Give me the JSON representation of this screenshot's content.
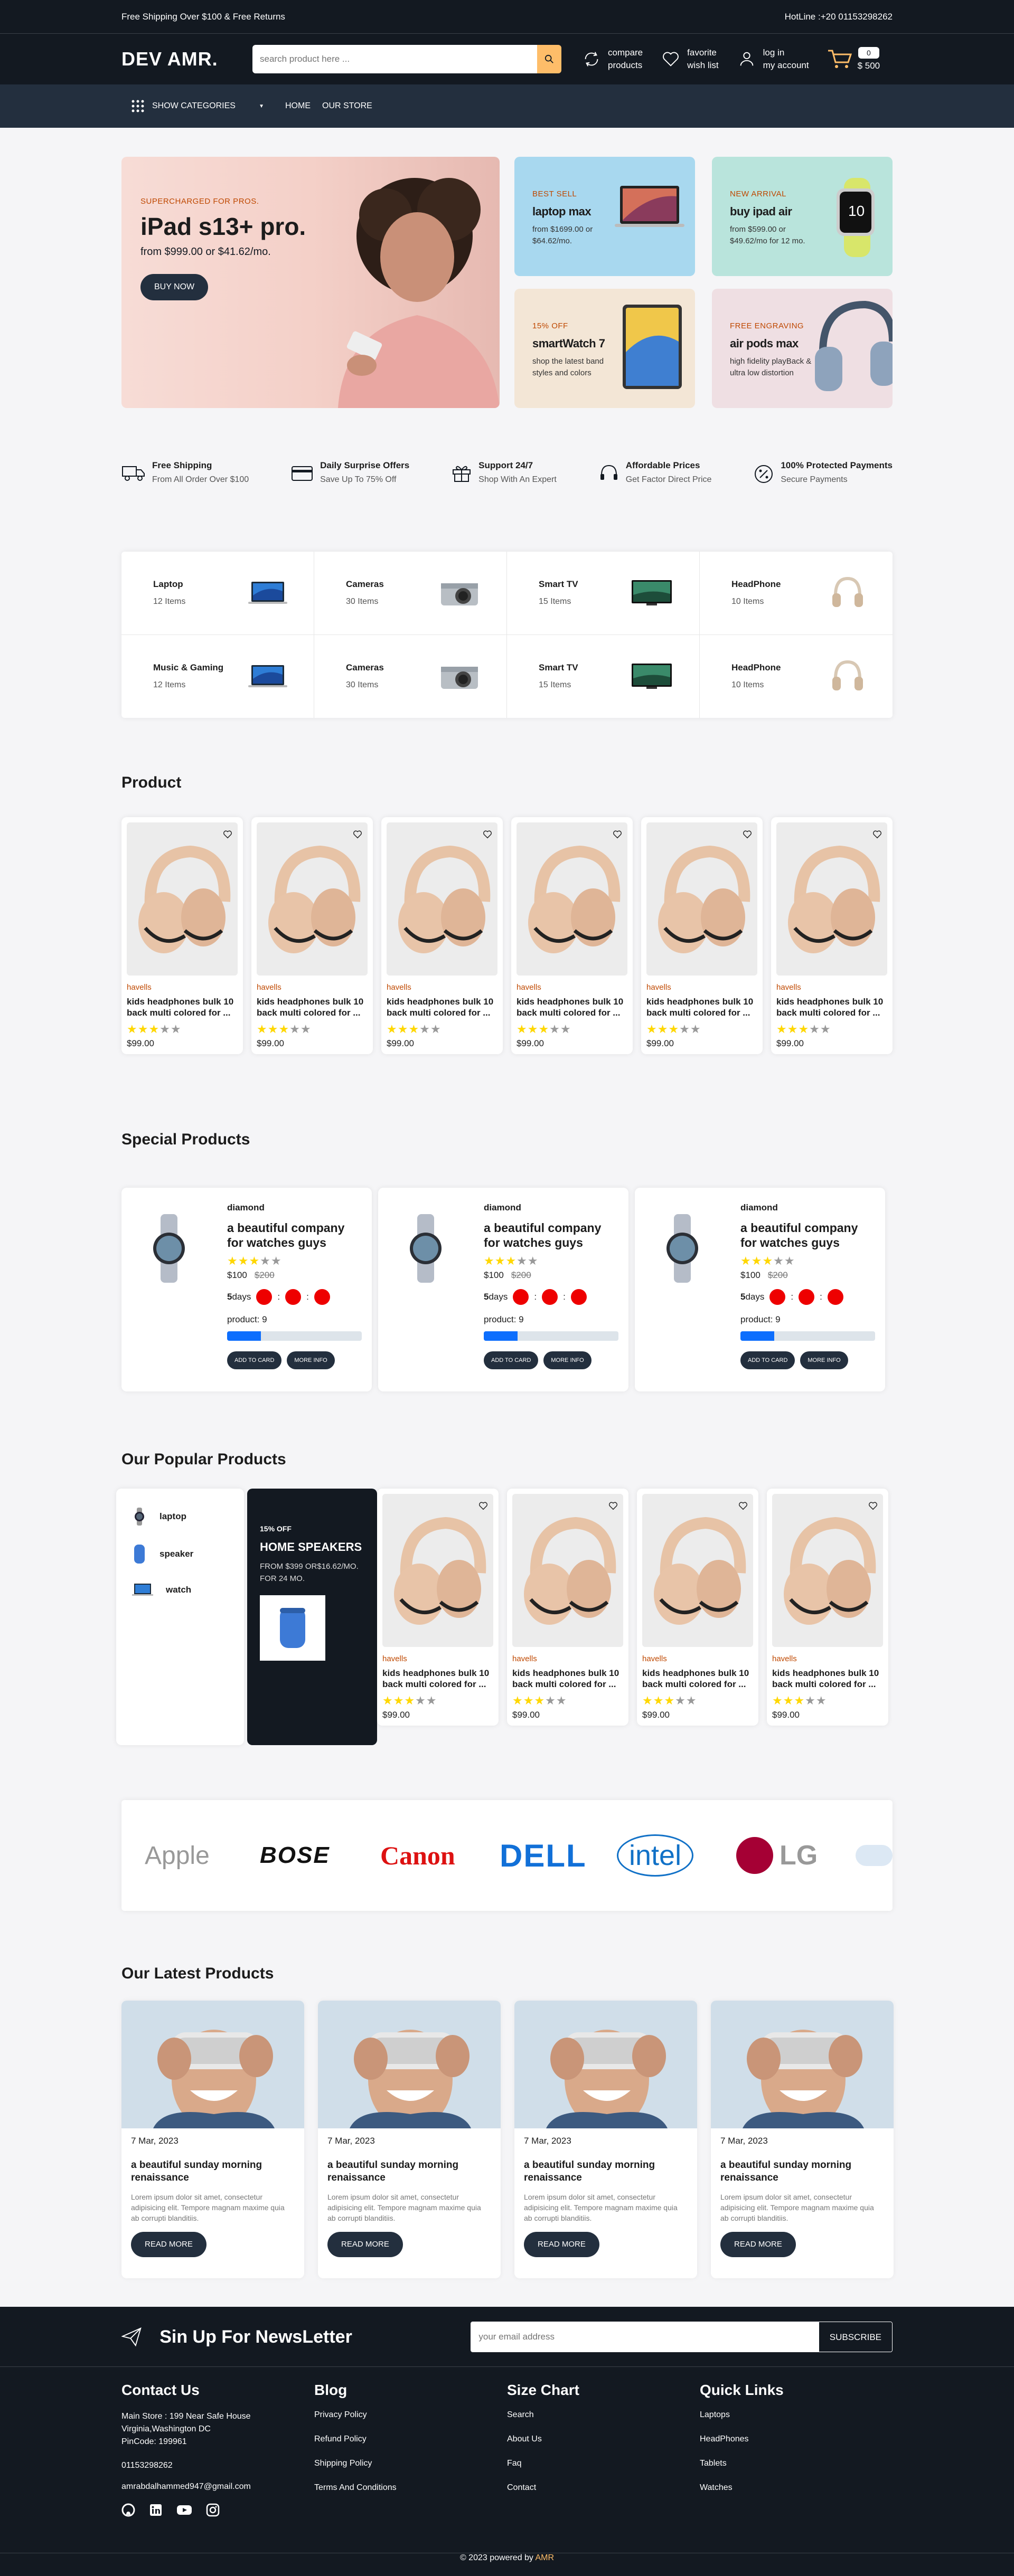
{
  "topbar": {
    "shipping": "Free Shipping Over $100 & Free Returns",
    "hotline": "HotLine :+20 01153298262"
  },
  "header": {
    "logo": "DEV AMR.",
    "search_placeholder": "search product here ...",
    "compare": [
      "compare",
      "products"
    ],
    "favorite": [
      "favorite",
      "wish list"
    ],
    "login": [
      "log in",
      "my account"
    ],
    "cart_count": "0",
    "cart_total": "$ 500"
  },
  "nav": {
    "categories": "SHOW CATEGORIES",
    "links": [
      "HOME",
      "OUR STORE"
    ]
  },
  "hero": {
    "main": {
      "sub": "SUPERCHARGED FOR PROS.",
      "title": "iPad s13+ pro.",
      "price": "from $999.00 or $41.62/mo.",
      "button": "BUY NOW"
    },
    "minis": [
      {
        "sub": "BEST SELL",
        "title": "laptop max",
        "text": "from $1699.00 or $64.62/mo.",
        "bg": "#a8d8ef"
      },
      {
        "sub": "NEW ARRIVAL",
        "title": "buy ipad air",
        "text": "from $599.00 or $49.62/mo for 12 mo.",
        "bg": "#b9e4dc"
      },
      {
        "sub": "15% OFF",
        "title": "smartWatch 7",
        "text": "shop the latest band styles and colors",
        "bg": "#f3e6d6"
      },
      {
        "sub": "FREE ENGRAVING",
        "title": "air pods max",
        "text": "high fidelity playBack & ultra low distortion",
        "bg": "#efdfe3"
      }
    ]
  },
  "services": [
    {
      "title": "Free Shipping",
      "text": "From All Order Over $100",
      "icon": "truck-icon"
    },
    {
      "title": "Daily Surprise Offers",
      "text": "Save Up To 75% Off",
      "icon": "card-icon"
    },
    {
      "title": "Support 24/7",
      "text": "Shop With An Expert",
      "icon": "gift-icon"
    },
    {
      "title": "Affordable Prices",
      "text": "Get Factor Direct Price",
      "icon": "headset-icon"
    },
    {
      "title": "100% Protected Payments",
      "text": "Secure Payments",
      "icon": "percent-icon"
    }
  ],
  "categories": [
    {
      "name": "Laptop",
      "count": "12 Items",
      "icon": "laptop-icon"
    },
    {
      "name": "Cameras",
      "count": "30 Items",
      "icon": "camera-icon"
    },
    {
      "name": "Smart TV",
      "count": "15 Items",
      "icon": "tv-icon"
    },
    {
      "name": "HeadPhone",
      "count": "10 Items",
      "icon": "headphone-icon"
    },
    {
      "name": "Music & Gaming",
      "count": "12 Items",
      "icon": "laptop-icon"
    },
    {
      "name": "Cameras",
      "count": "30 Items",
      "icon": "camera-icon"
    },
    {
      "name": "Smart TV",
      "count": "15 Items",
      "icon": "tv-icon"
    },
    {
      "name": "HeadPhone",
      "count": "10 Items",
      "icon": "headphone-icon"
    }
  ],
  "sections": {
    "product": "Product",
    "special": "Special Products",
    "popular": "Our Popular Products",
    "latest": "Our Latest Products"
  },
  "product": {
    "brand": "havells",
    "title": "kids headphones bulk 10 back multi colored for ...",
    "price": "$99.00",
    "rating": 3
  },
  "special": {
    "brand": "diamond",
    "title": "a beautiful company for watches guys",
    "price": "$100",
    "old_price": "$200",
    "days": "5",
    "days_label": "days",
    "count_label": "product: 9",
    "progress": 0.25,
    "add": "ADD TO CARD",
    "more": "MORE INFO",
    "rating": 3
  },
  "popular_list": [
    "laptop",
    "speaker",
    "watch"
  ],
  "speaker": {
    "sub": "15% OFF",
    "title": "HOME SPEAKERS",
    "text": "FROM $399 OR$16.62/MO. FOR 24 MO."
  },
  "brands": [
    "Apple",
    "BOSE",
    "Canon",
    "DELL",
    "intel",
    "LG"
  ],
  "blog": {
    "date": "7 Mar, 2023",
    "title": "a beautiful sunday morning renaissance",
    "text": "Lorem ipsum dolor sit amet, consectetur adipisicing elit. Tempore magnam maxime quia ab corrupti blanditiis.",
    "button": "READ MORE"
  },
  "newsletter": {
    "title": "Sin Up For NewsLetter",
    "placeholder": "your email address",
    "button": "SUBSCRIBE"
  },
  "footer": {
    "contact_title": "Contact Us",
    "address": [
      "Main Store : 199 Near Safe House",
      "Virginia,Washington DC",
      "PinCode: 199961"
    ],
    "phone": "01153298262",
    "email": "amrabdalhammed947@gmail.com",
    "cols": [
      {
        "title": "Blog",
        "links": [
          "Privacy Policy",
          "Refund Policy",
          "Shipping Policy",
          "Terms And Conditions"
        ]
      },
      {
        "title": "Size Chart",
        "links": [
          "Search",
          "About Us",
          "Faq",
          "Contact"
        ]
      },
      {
        "title": "Quick Links",
        "links": [
          "Laptops",
          "HeadPhones",
          "Tablets",
          "Watches"
        ]
      }
    ],
    "copyright": "© 2023 powered by",
    "copyright_name": "AMR"
  },
  "colors": {
    "dark": "#131921",
    "nav": "#232f3e",
    "accent": "#febd69",
    "brand_text": "#bf4800"
  }
}
